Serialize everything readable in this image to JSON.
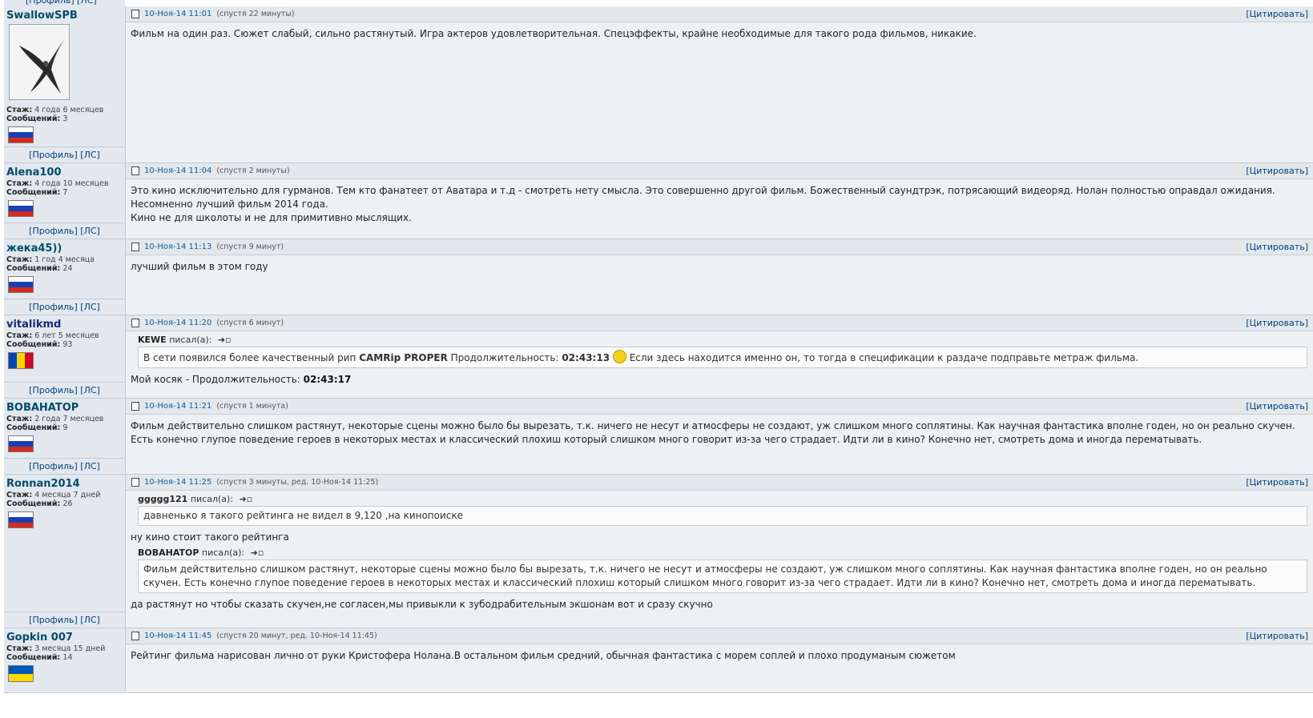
{
  "labels": {
    "profile": "[Профиль]",
    "pm": "[ЛС]",
    "quote": "[Цитировать]",
    "wrote": "писал(а):",
    "tenure": "Стаж:",
    "messages": "Сообщений:"
  },
  "posts": [
    {
      "user": "SwallowSPB",
      "tenure": "4 года 6 месяцев",
      "messages": "3",
      "flag": "ru",
      "date": "10-Ноя-14 11:01",
      "meta": "(спустя 22 минуты)",
      "text1": "Фильм на один раз. Сюжет слабый, сильно растянутый. Игра актеров удовлетворительная. Спецэффекты, крайне необходимые для такого рода фильмов, никакие."
    },
    {
      "user": "Alena100",
      "tenure": "4 года 10 месяцев",
      "messages": "7",
      "flag": "ru",
      "date": "10-Ноя-14 11:04",
      "meta": "(спустя 2 минуты)",
      "text1": "Это кино исключительно для гурманов. Тем кто фанатеет от Аватара и т.д - смотреть нету смысла. Это совершенно другой фильм. Божественный саундтрэк, потрясающий видеоряд. Нолан полностью оправдал ожидания.",
      "text2": "Несомненно лучший фильм 2014 года.",
      "text3": "Кино не для школоты и не для примитивно мыслящих."
    },
    {
      "user": "жека45))",
      "tenure": "1 год 4 месяца",
      "messages": "24",
      "flag": "ru",
      "date": "10-Ноя-14 11:13",
      "meta": "(спустя 9 минут)",
      "text1": "лучший фильм в этом году"
    },
    {
      "user": "vitalikmd",
      "tenure": "6 лет 5 месяцев",
      "messages": "93",
      "flag": "md",
      "date": "10-Ноя-14 11:20",
      "meta": "(спустя 6 минут)",
      "quote_author": "KEWE",
      "quote_a": "В сети появился более качественный рип ",
      "quote_b": "CAMRip PROPER",
      "quote_c": " Продолжительность: ",
      "quote_d": "02:43:13",
      "quote_e": " Если здесь находится именно он, то тогда в спецификации к раздаче подправьте метраж фильма.",
      "reply_a": "Мой косяк - Продолжительность: ",
      "reply_b": "02:43:17"
    },
    {
      "user": "BOBAHATOP",
      "tenure": "2 года 7 месяцев",
      "messages": "9",
      "flag": "ru",
      "date": "10-Ноя-14 11:21",
      "meta": "(спустя 1 минута)",
      "text1": "Фильм действительно слишком растянут, некоторые сцены можно было бы вырезать, т.к. ничего не несут и атмосферы не создают, уж слишком много соплятины. Как научная фантастика вполне годен, но он реально скучен. Есть конечно глупое поведение героев в некоторых местах и классический плохиш который слишком много говорит из-за чего страдает. Идти ли в кино? Конечно нет, смотреть дома и иногда перематывать."
    },
    {
      "user": "Ronnan2014",
      "tenure": "4 месяца 7 дней",
      "messages": "26",
      "flag": "ru",
      "date": "10-Ноя-14 11:25",
      "meta": "(спустя 3 минуты, ред. 10-Ноя-14 11:25)",
      "quote1_author": "ggggg121",
      "quote1_text": "давненько я такого рейтинга не видел в 9,120 ,на кинопоиске",
      "reply1": "ну кино стоит такого рейтинга",
      "quote2_author": "BOBAHATOP",
      "quote2_text": "Фильм действительно слишком растянут, некоторые сцены можно было бы вырезать, т.к. ничего не несут и атмосферы не создают, уж слишком много соплятины. Как научная фантастика вполне годен, но он реально скучен. Есть конечно глупое поведение героев в некоторых местах и классический плохиш который слишком много говорит из-за чего страдает. Идти ли в кино? Конечно нет, смотреть дома и иногда перематывать.",
      "reply2": "да растянут но чтобы сказать скучен,не согласен,мы привыкли к зубодрабительным экшонам вот и сразу скучно"
    },
    {
      "user": "Gopkin 007",
      "tenure": "3 месяца 15 дней",
      "messages": "14",
      "flag": "ua",
      "date": "10-Ноя-14 11:45",
      "meta": "(спустя 20 минут, ред. 10-Ноя-14 11:45)",
      "text1": "Рейтинг фильма нарисован лично от руки Кристофера Нолана.В остальном фильм средний, обычная фантастика с морем соплей и плохо продуманым сюжетом"
    }
  ],
  "colors": {
    "link": "#00407c",
    "date": "#0a5a9a",
    "nick": "#034c6b",
    "left_bg": "#e2e8ee",
    "right_bg": "#eef1f4"
  },
  "icons": {
    "post": "post-icon",
    "goto": "goto-arrow-icon",
    "smile": "smiley-icon"
  }
}
